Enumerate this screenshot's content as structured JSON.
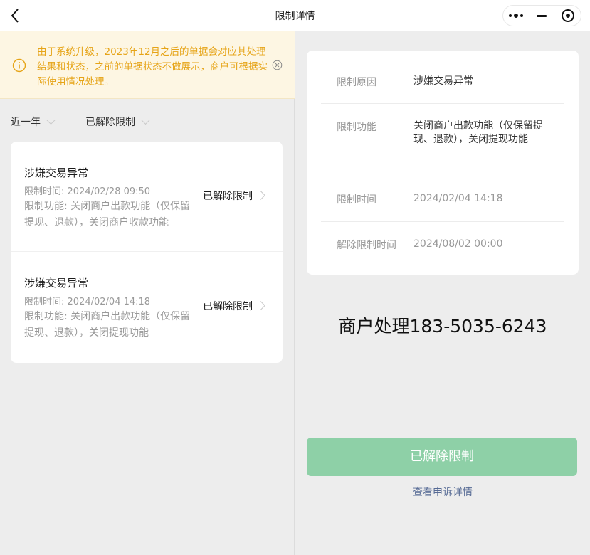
{
  "header": {
    "title": "限制详情",
    "back_icon": "back-arrow-icon",
    "menu_icon": "more-dots-icon",
    "minimize_icon": "minimize-icon",
    "close_icon": "target-close-icon"
  },
  "notice": {
    "text": "由于系统升级，2023年12月之后的单据会对应其处理结果和状态，之前的单据状态不做展示，商户可根据实际使用情况处理。",
    "color": "#e6a417",
    "background": "#fdf6e3"
  },
  "filters": {
    "period": "近一年",
    "status": "已解除限制"
  },
  "records": [
    {
      "title": "涉嫌交易异常",
      "time_label": "限制时间:",
      "time_value": "2024/02/28 09:50",
      "function_text": "限制功能: 关闭商户出款功能（仅保留提现、退款），关闭商户收款功能",
      "status": "已解除限制"
    },
    {
      "title": "涉嫌交易异常",
      "time_label": "限制时间:",
      "time_value": "2024/02/04 14:18",
      "function_text": "限制功能: 关闭商户出款功能（仅保留提现、退款），关闭提现功能",
      "status": "已解除限制"
    }
  ],
  "detail": {
    "rows": [
      {
        "label": "限制原因",
        "value": "涉嫌交易异常"
      },
      {
        "label": "限制功能",
        "value": "关闭商户出款功能（仅保留提现、退款），关闭提现功能"
      },
      {
        "label": "限制时间",
        "value": "2024/02/04 14:18"
      },
      {
        "label": "解除限制时间",
        "value": "2024/08/02 00:00"
      }
    ]
  },
  "merchant_text": "商户处理183-5035-6243",
  "actions": {
    "primary_label": "已解除限制",
    "primary_color": "#8ed0a7",
    "appeal_link": "查看申诉详情",
    "link_color": "#576b95"
  }
}
